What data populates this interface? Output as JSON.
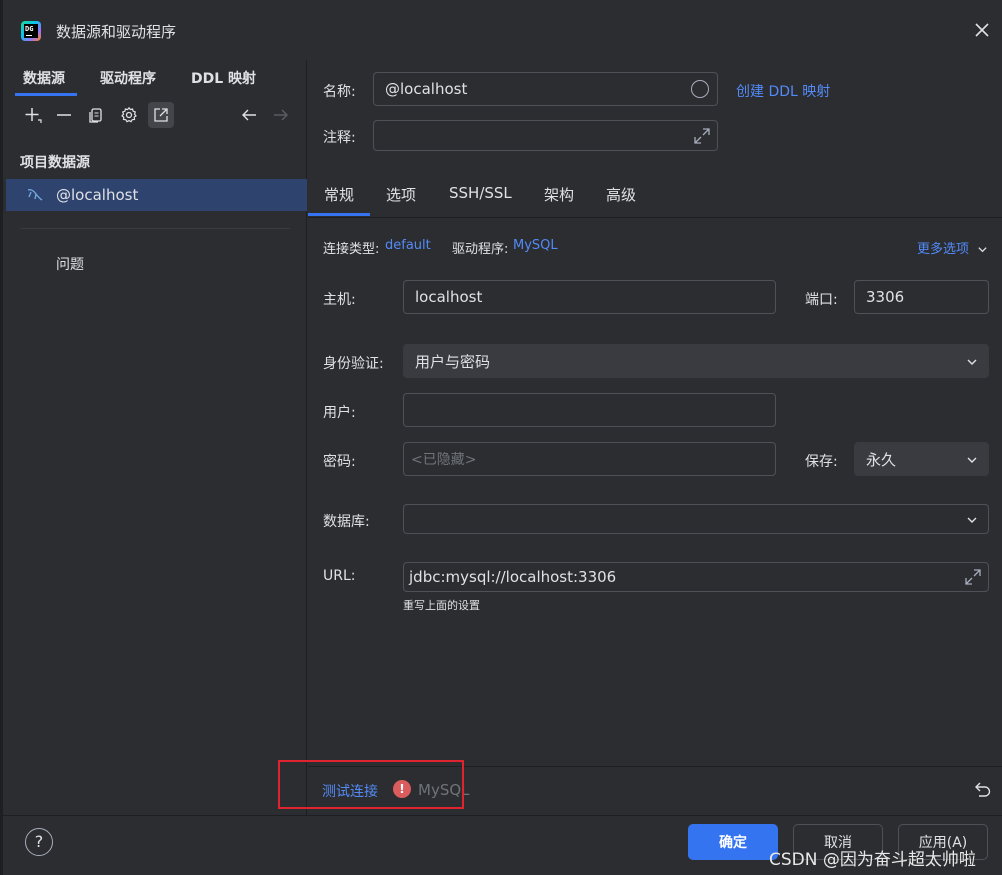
{
  "window": {
    "title": "数据源和驱动程序",
    "left_tabs": [
      "数据源",
      "驱动程序",
      "DDL 映射"
    ]
  },
  "sidebar": {
    "section_title": "项目数据源",
    "datasource": "@localhost",
    "problems_label": "问题"
  },
  "header": {
    "name_label": "名称:",
    "name_value": "@localhost",
    "create_ddl_link": "创建 DDL 映射",
    "comment_label": "注释:"
  },
  "tabs": [
    "常规",
    "选项",
    "SSH/SSL",
    "架构",
    "高级"
  ],
  "general": {
    "conn_type_label": "连接类型:",
    "conn_type_value": "default",
    "driver_label": "驱动程序:",
    "driver_value": "MySQL",
    "more_options": "更多选项",
    "host_label": "主机:",
    "host_value": "localhost",
    "port_label": "端口:",
    "port_value": "3306",
    "auth_label": "身份验证:",
    "auth_value": "用户与密码",
    "user_label": "用户:",
    "password_label": "密码:",
    "password_placeholder": "<已隐藏>",
    "save_label": "保存:",
    "save_value": "永久",
    "database_label": "数据库:",
    "url_label": "URL:",
    "url_value": "jdbc:mysql://localhost:3306",
    "url_hint": "重写上面的设置"
  },
  "status": {
    "test_connection": "测试连接",
    "driver_name": "MySQL"
  },
  "footer": {
    "help": "?",
    "ok": "确定",
    "cancel": "取消",
    "apply": "应用(A)",
    "watermark": "CSDN @因为奋斗超太帅啦"
  },
  "colors": {
    "accent": "#3574f0",
    "link": "#548af7",
    "selection": "#2e436e",
    "error": "#db5c5c",
    "highlight_box": "#e0242f"
  }
}
